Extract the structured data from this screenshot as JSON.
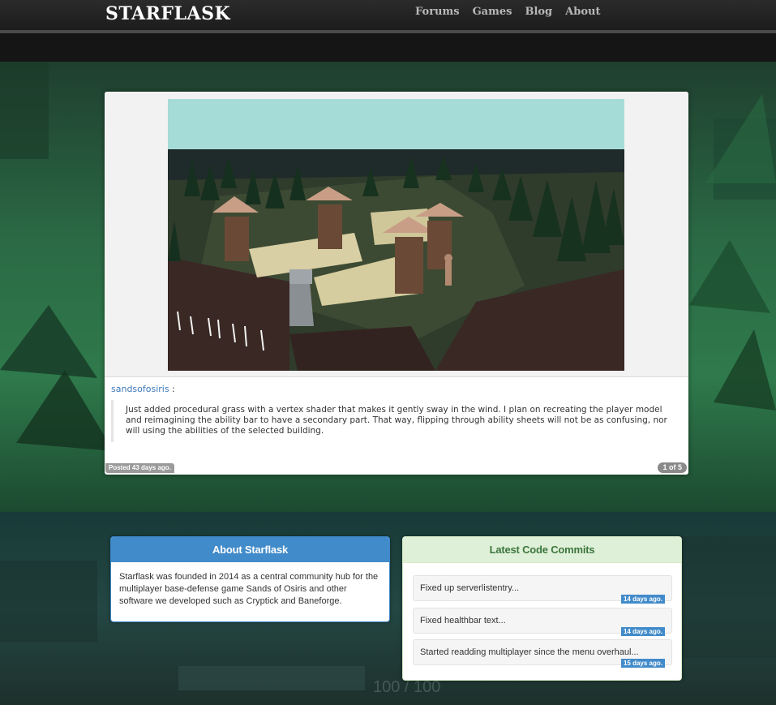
{
  "brand": "STARFLASK",
  "nav": {
    "items": [
      "Forums",
      "Games",
      "Blog",
      "About"
    ]
  },
  "post": {
    "author": "sandsofosiris",
    "colon": ":",
    "text": "Just added procedural grass with a vertex shader that makes it gently sway in the wind.   I plan on recreating the player model and reimagining the ability bar to have a secondary part.  That way, flipping through ability sheets will not be as confusing, nor will using the abilities of the selected building.",
    "posted": "Posted 43 days ago.",
    "pagination": "1 of 5"
  },
  "about": {
    "title": "About Starflask",
    "body": "Starflask was founded in 2014 as a central community hub for the multiplayer base-defense game Sands of Osiris and other software we developed such as Cryptick and Baneforge."
  },
  "commits": {
    "title": "Latest Code Commits",
    "items": [
      {
        "text": "Fixed up serverlistentry...",
        "age": "14 days ago."
      },
      {
        "text": "Fixed healthbar text...",
        "age": "14 days ago."
      },
      {
        "text": "Started readding multiplayer since the menu overhaul...",
        "age": "15 days ago."
      }
    ]
  },
  "background_text": "100 / 100",
  "colors": {
    "accent_blue": "#428bca",
    "success_bg": "#dff0d8",
    "success_text": "#3c763d",
    "navbar": "#222222",
    "hero_green": "#2f7a4c"
  }
}
